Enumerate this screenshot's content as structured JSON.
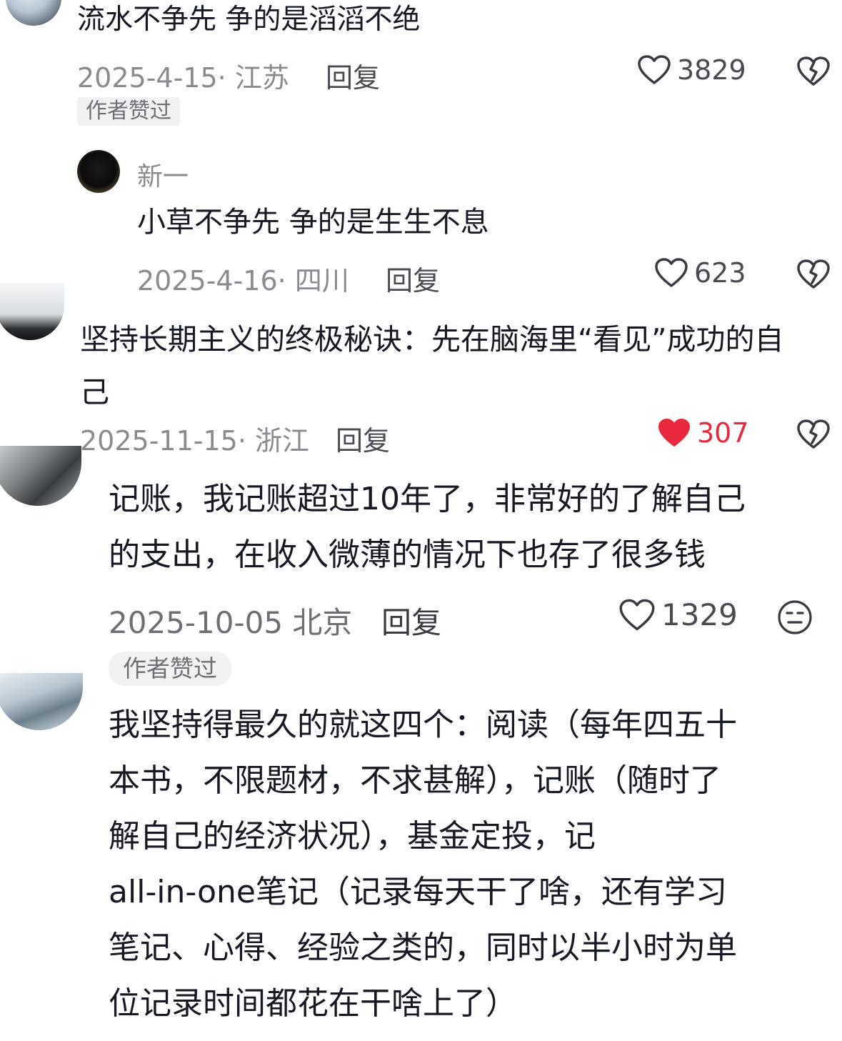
{
  "comments": [
    {
      "text": "流水不争先 争的是滔滔不绝",
      "meta": "2025-4-15· 江苏",
      "reply_label": "回复",
      "likes": "3829",
      "liked": false,
      "author_liked_badge": "作者赞过",
      "reply": {
        "username": "新一",
        "text": "小草不争先 争的是生生不息",
        "meta": "2025-4-16· 四川",
        "reply_label": "回复",
        "likes": "623",
        "liked": false
      }
    },
    {
      "text_lines": [
        "坚持长期主义的终极秘诀：先在脑海里“看见”成功的自",
        "己"
      ],
      "meta": "2025-11-15· 浙江",
      "reply_label": "回复",
      "likes": "307",
      "liked": true
    },
    {
      "text_lines": [
        "记账，我记账超过10年了，非常好的了解自己",
        "的支出，在收入微薄的情况下也存了很多钱"
      ],
      "meta": "2025-10-05 北京",
      "reply_label": "回复",
      "likes": "1329",
      "liked": false,
      "author_liked_badge": "作者赞过"
    },
    {
      "text_lines": [
        "我坚持得最久的就这四个：阅读（每年四五十",
        "本书，不限题材，不求甚解），记账（随时了",
        "解自己的经济状况），基金定投，记",
        "all-in-one笔记（记录每天干了啥，还有学习",
        "笔记、心得、经验之类的，同时以半小时为单",
        "位记录时间都花在干啥上了）"
      ]
    }
  ],
  "colors": {
    "like_red": "#e8283c",
    "meta_gray": "#8a8b91"
  },
  "icons": {
    "like": "heart-outline-icon",
    "liked": "heart-filled-icon",
    "dislike": "broken-heart-icon",
    "neutral": "neutral-face-icon"
  }
}
